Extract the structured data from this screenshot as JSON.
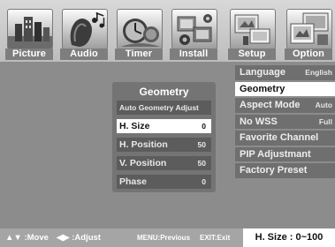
{
  "tabs": [
    {
      "label": "Picture",
      "icon": "picture-icon"
    },
    {
      "label": "Audio",
      "icon": "audio-icon"
    },
    {
      "label": "Timer",
      "icon": "timer-icon"
    },
    {
      "label": "Install",
      "icon": "install-icon"
    },
    {
      "label": "Setup",
      "icon": "setup-icon"
    },
    {
      "label": "Option",
      "icon": "option-icon"
    }
  ],
  "setup_menu": {
    "items": [
      {
        "label": "Language",
        "value": "English"
      },
      {
        "label": "Geometry",
        "value": "",
        "selected": true
      },
      {
        "label": "Aspect Mode",
        "value": "Auto"
      },
      {
        "label": "No WSS",
        "value": "Full"
      },
      {
        "label": "Favorite Channel",
        "value": ""
      },
      {
        "label": "PIP Adjustmant",
        "value": ""
      },
      {
        "label": "Factory Preset",
        "value": ""
      }
    ]
  },
  "geometry_panel": {
    "title": "Geometry",
    "items": [
      {
        "label": "Auto Geometry Adjust",
        "value": ""
      },
      {
        "label": "H. Size",
        "value": "0",
        "selected": true
      },
      {
        "label": "H. Position",
        "value": "50"
      },
      {
        "label": "V. Position",
        "value": "50"
      },
      {
        "label": "Phase",
        "value": "0"
      }
    ]
  },
  "bottom_bar": {
    "move": "▲▼ :Move",
    "adjust": "◀▶ :Adjust",
    "previous": "MENU:Previous",
    "exit": "EXIT:Exit",
    "range": "H. Size : 0~100"
  },
  "colors": {
    "background": "#8c8c8c",
    "menu_item": "#6f6f6f",
    "panel": "#747474",
    "highlight": "#ffffff"
  }
}
